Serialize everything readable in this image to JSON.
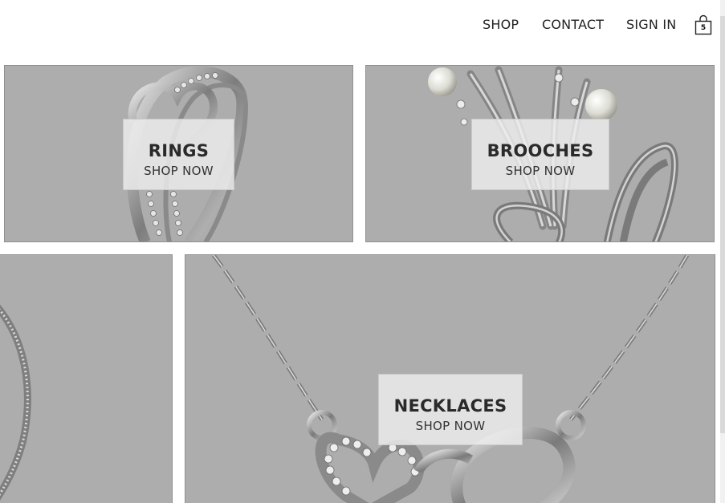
{
  "nav": {
    "shop": "SHOP",
    "contact": "CONTACT",
    "sign_in": "SIGN IN",
    "cart_icon": "shopping-bag-icon",
    "cart_count": "5"
  },
  "tiles": [
    {
      "title": "RINGS",
      "cta": "SHOP NOW"
    },
    {
      "title": "BROOCHES",
      "cta": "SHOP NOW"
    },
    {
      "title": "",
      "cta": ""
    },
    {
      "title": "NECKLACES",
      "cta": "SHOP NOW"
    }
  ],
  "colors": {
    "tile_overlay": "#adadad",
    "label_box": "#eeeeee",
    "text": "#222222"
  }
}
